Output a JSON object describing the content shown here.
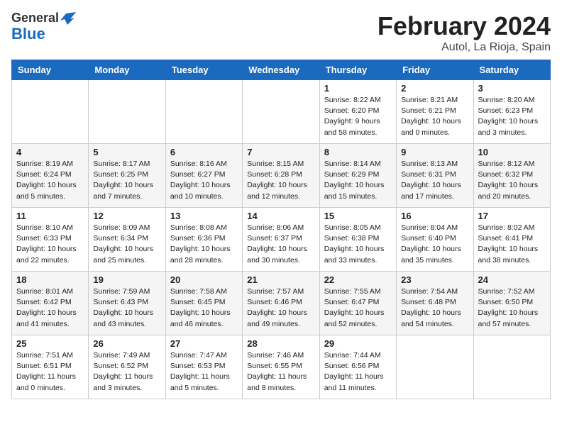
{
  "header": {
    "logo_general": "General",
    "logo_blue": "Blue",
    "title": "February 2024",
    "subtitle": "Autol, La Rioja, Spain"
  },
  "days": [
    "Sunday",
    "Monday",
    "Tuesday",
    "Wednesday",
    "Thursday",
    "Friday",
    "Saturday"
  ],
  "weeks": [
    [
      {
        "date": "",
        "info": ""
      },
      {
        "date": "",
        "info": ""
      },
      {
        "date": "",
        "info": ""
      },
      {
        "date": "",
        "info": ""
      },
      {
        "date": "1",
        "info": "Sunrise: 8:22 AM\nSunset: 6:20 PM\nDaylight: 9 hours\nand 58 minutes."
      },
      {
        "date": "2",
        "info": "Sunrise: 8:21 AM\nSunset: 6:21 PM\nDaylight: 10 hours\nand 0 minutes."
      },
      {
        "date": "3",
        "info": "Sunrise: 8:20 AM\nSunset: 6:23 PM\nDaylight: 10 hours\nand 3 minutes."
      }
    ],
    [
      {
        "date": "4",
        "info": "Sunrise: 8:19 AM\nSunset: 6:24 PM\nDaylight: 10 hours\nand 5 minutes."
      },
      {
        "date": "5",
        "info": "Sunrise: 8:17 AM\nSunset: 6:25 PM\nDaylight: 10 hours\nand 7 minutes."
      },
      {
        "date": "6",
        "info": "Sunrise: 8:16 AM\nSunset: 6:27 PM\nDaylight: 10 hours\nand 10 minutes."
      },
      {
        "date": "7",
        "info": "Sunrise: 8:15 AM\nSunset: 6:28 PM\nDaylight: 10 hours\nand 12 minutes."
      },
      {
        "date": "8",
        "info": "Sunrise: 8:14 AM\nSunset: 6:29 PM\nDaylight: 10 hours\nand 15 minutes."
      },
      {
        "date": "9",
        "info": "Sunrise: 8:13 AM\nSunset: 6:31 PM\nDaylight: 10 hours\nand 17 minutes."
      },
      {
        "date": "10",
        "info": "Sunrise: 8:12 AM\nSunset: 6:32 PM\nDaylight: 10 hours\nand 20 minutes."
      }
    ],
    [
      {
        "date": "11",
        "info": "Sunrise: 8:10 AM\nSunset: 6:33 PM\nDaylight: 10 hours\nand 22 minutes."
      },
      {
        "date": "12",
        "info": "Sunrise: 8:09 AM\nSunset: 6:34 PM\nDaylight: 10 hours\nand 25 minutes."
      },
      {
        "date": "13",
        "info": "Sunrise: 8:08 AM\nSunset: 6:36 PM\nDaylight: 10 hours\nand 28 minutes."
      },
      {
        "date": "14",
        "info": "Sunrise: 8:06 AM\nSunset: 6:37 PM\nDaylight: 10 hours\nand 30 minutes."
      },
      {
        "date": "15",
        "info": "Sunrise: 8:05 AM\nSunset: 6:38 PM\nDaylight: 10 hours\nand 33 minutes."
      },
      {
        "date": "16",
        "info": "Sunrise: 8:04 AM\nSunset: 6:40 PM\nDaylight: 10 hours\nand 35 minutes."
      },
      {
        "date": "17",
        "info": "Sunrise: 8:02 AM\nSunset: 6:41 PM\nDaylight: 10 hours\nand 38 minutes."
      }
    ],
    [
      {
        "date": "18",
        "info": "Sunrise: 8:01 AM\nSunset: 6:42 PM\nDaylight: 10 hours\nand 41 minutes."
      },
      {
        "date": "19",
        "info": "Sunrise: 7:59 AM\nSunset: 6:43 PM\nDaylight: 10 hours\nand 43 minutes."
      },
      {
        "date": "20",
        "info": "Sunrise: 7:58 AM\nSunset: 6:45 PM\nDaylight: 10 hours\nand 46 minutes."
      },
      {
        "date": "21",
        "info": "Sunrise: 7:57 AM\nSunset: 6:46 PM\nDaylight: 10 hours\nand 49 minutes."
      },
      {
        "date": "22",
        "info": "Sunrise: 7:55 AM\nSunset: 6:47 PM\nDaylight: 10 hours\nand 52 minutes."
      },
      {
        "date": "23",
        "info": "Sunrise: 7:54 AM\nSunset: 6:48 PM\nDaylight: 10 hours\nand 54 minutes."
      },
      {
        "date": "24",
        "info": "Sunrise: 7:52 AM\nSunset: 6:50 PM\nDaylight: 10 hours\nand 57 minutes."
      }
    ],
    [
      {
        "date": "25",
        "info": "Sunrise: 7:51 AM\nSunset: 6:51 PM\nDaylight: 11 hours\nand 0 minutes."
      },
      {
        "date": "26",
        "info": "Sunrise: 7:49 AM\nSunset: 6:52 PM\nDaylight: 11 hours\nand 3 minutes."
      },
      {
        "date": "27",
        "info": "Sunrise: 7:47 AM\nSunset: 6:53 PM\nDaylight: 11 hours\nand 5 minutes."
      },
      {
        "date": "28",
        "info": "Sunrise: 7:46 AM\nSunset: 6:55 PM\nDaylight: 11 hours\nand 8 minutes."
      },
      {
        "date": "29",
        "info": "Sunrise: 7:44 AM\nSunset: 6:56 PM\nDaylight: 11 hours\nand 11 minutes."
      },
      {
        "date": "",
        "info": ""
      },
      {
        "date": "",
        "info": ""
      }
    ]
  ]
}
